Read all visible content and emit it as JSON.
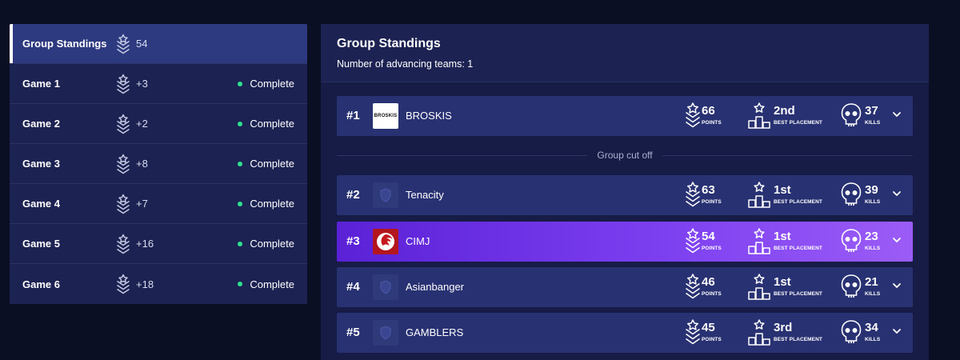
{
  "sidebar": {
    "items": [
      {
        "label": "Group Standings",
        "points": "54",
        "status": "",
        "active": true
      },
      {
        "label": "Game 1",
        "points": "+3",
        "status": "Complete",
        "active": false
      },
      {
        "label": "Game 2",
        "points": "+2",
        "status": "Complete",
        "active": false
      },
      {
        "label": "Game 3",
        "points": "+8",
        "status": "Complete",
        "active": false
      },
      {
        "label": "Game 4",
        "points": "+7",
        "status": "Complete",
        "active": false
      },
      {
        "label": "Game 5",
        "points": "+16",
        "status": "Complete",
        "active": false
      },
      {
        "label": "Game 6",
        "points": "+18",
        "status": "Complete",
        "active": false
      }
    ]
  },
  "main": {
    "title": "Group Standings",
    "advancing_text": "Number of advancing teams: 1",
    "cutoff_label": "Group cut off",
    "stat_labels": {
      "points": "POINTS",
      "placement": "BEST PLACEMENT",
      "kills": "KILLS"
    },
    "teams": [
      {
        "rank": "#1",
        "name": "BROSKIS",
        "logo_text": "BROSKIS",
        "points": "66",
        "placement": "2nd",
        "kills": "37",
        "highlight": false
      },
      {
        "rank": "#2",
        "name": "Tenacity",
        "logo_text": "",
        "points": "63",
        "placement": "1st",
        "kills": "39",
        "highlight": false
      },
      {
        "rank": "#3",
        "name": "CIMJ",
        "logo_text": "",
        "points": "54",
        "placement": "1st",
        "kills": "23",
        "highlight": true
      },
      {
        "rank": "#4",
        "name": "Asianbanger",
        "logo_text": "",
        "points": "46",
        "placement": "1st",
        "kills": "21",
        "highlight": false
      },
      {
        "rank": "#5",
        "name": "GAMBLERS",
        "logo_text": "",
        "points": "45",
        "placement": "3rd",
        "kills": "34",
        "highlight": false
      }
    ]
  },
  "colors": {
    "background": "#0a0f24",
    "sidebar": "#1c2352",
    "sidebar_active": "#2e3a80",
    "row": "#283171",
    "highlight_start": "#5b21d6",
    "highlight_end": "#9b5cf6",
    "status_dot": "#2fe08c"
  },
  "icons": {
    "points": "points-badge-icon",
    "placement": "podium-star-icon",
    "kills": "skull-icon",
    "expand": "chevron-down-icon"
  }
}
